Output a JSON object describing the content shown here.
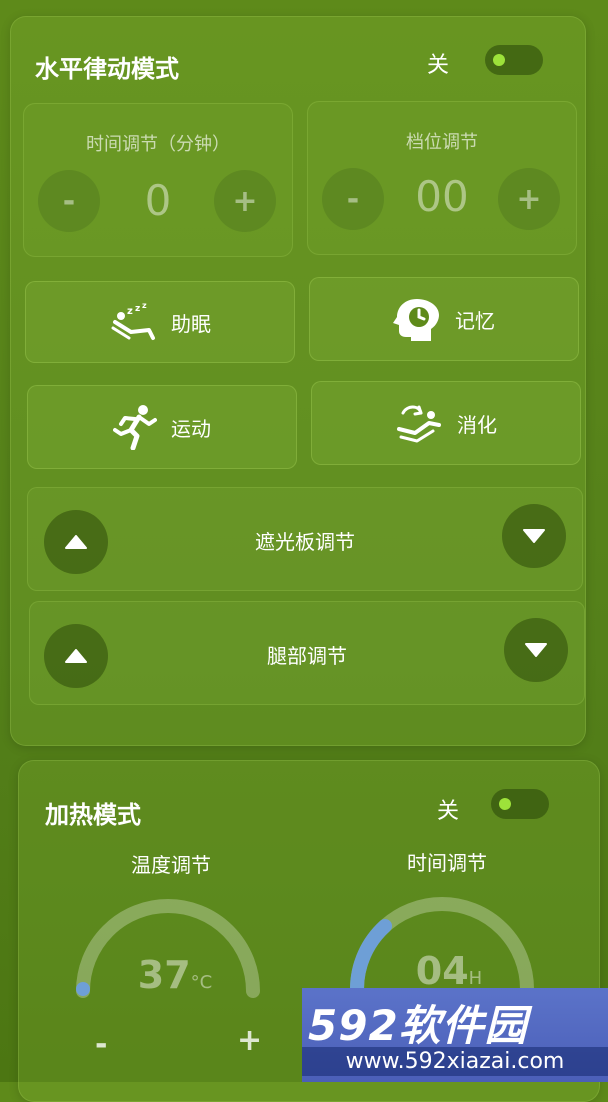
{
  "rhythm_card": {
    "title": "水平律动模式",
    "toggle_label": "关",
    "time_panel": {
      "label": "时间调节（分钟）",
      "minus": "-",
      "value": "0",
      "plus": "+"
    },
    "gear_panel": {
      "label": "档位调节",
      "minus": "-",
      "value": "00",
      "plus": "+"
    },
    "modes": [
      {
        "label": "助眠",
        "icon": "sleep-recline-icon"
      },
      {
        "label": "记忆",
        "icon": "memory-head-clock-icon"
      },
      {
        "label": "运动",
        "icon": "running-person-icon"
      },
      {
        "label": "消化",
        "icon": "digest-recline-icon"
      }
    ],
    "adjusters": [
      {
        "label": "遮光板调节"
      },
      {
        "label": "腿部调节"
      }
    ]
  },
  "heat_card": {
    "title": "加热模式",
    "toggle_label": "关",
    "temperature": {
      "label": "温度调节",
      "value": "37",
      "unit": "°C",
      "minus": "-",
      "plus": "+"
    },
    "time": {
      "label": "时间调节",
      "value": "04",
      "unit": "H"
    }
  },
  "watermark": {
    "brand_num": "592",
    "brand_text": "软件园",
    "url": "www.592xiazai.com"
  },
  "colors": {
    "background": "#5a8619",
    "toggle_dot": "#9de23a",
    "gauge_progress": "#6e9fd6",
    "watermark_blue": "#4b5fb8"
  }
}
